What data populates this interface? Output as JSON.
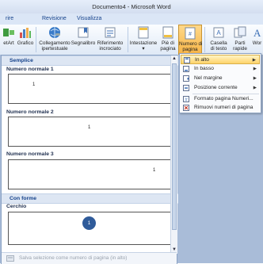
{
  "window": {
    "title": "Documento4 - Microsoft Word"
  },
  "tabs": [
    {
      "label": "rire"
    },
    {
      "label": "Revisione"
    },
    {
      "label": "Visualizza"
    }
  ],
  "ribbon": {
    "smartart": "etArt",
    "grafico": "Grafico",
    "collegamento": "Collegamento",
    "collegamento2": "ipertestuale",
    "segnalibro": "Segnalibro",
    "riferimento": "Riferimento",
    "riferimento2": "incrociato",
    "intestazione": "Intestazione",
    "piede": "Piè di",
    "piede2": "pagina",
    "numero": "Numero di",
    "numero2": "pagina",
    "casella": "Casella",
    "casella2": "di testo",
    "parti": "Parti",
    "parti2": "rapide",
    "wor": "Wor"
  },
  "gallery": {
    "section1": "Semplice",
    "items": [
      {
        "name": "Numero normale 1",
        "pn": "1"
      },
      {
        "name": "Numero normale 2",
        "pn": "1"
      },
      {
        "name": "Numero normale 3",
        "pn": "1"
      }
    ],
    "section2": "Con forme",
    "shape_item": "Cerchio",
    "circle_num": "1",
    "footer": "Salva selezione come numero di pagina (in alto)"
  },
  "menu": {
    "items": [
      {
        "label": "In alto"
      },
      {
        "label": "In basso"
      },
      {
        "label": "Nel margine"
      },
      {
        "label": "Posizione corrente"
      },
      {
        "label": "Formato pagina Numeri..."
      },
      {
        "label": "Rimuovi numeri di pagina"
      }
    ]
  }
}
